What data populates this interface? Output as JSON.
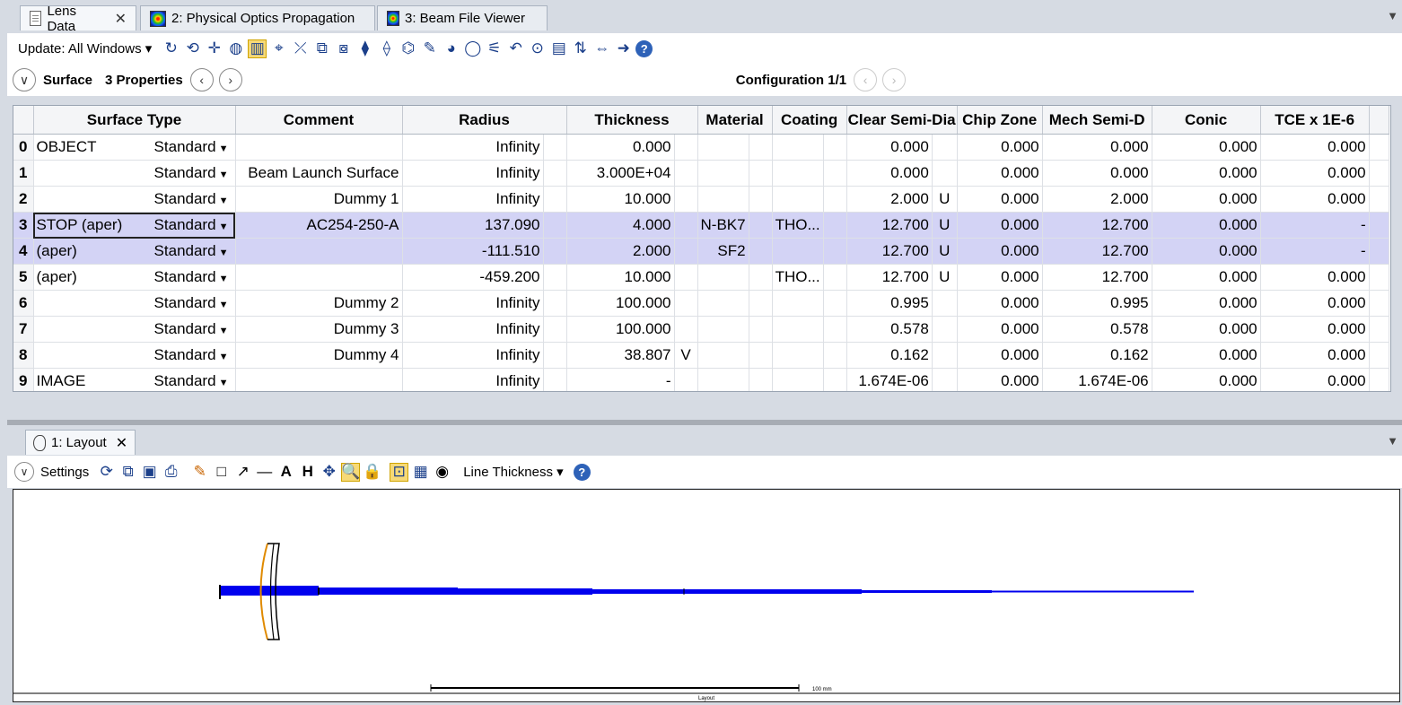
{
  "tabs": [
    {
      "label": "Lens Data",
      "icon": "document-icon",
      "active": true
    },
    {
      "label": "2: Physical Optics Propagation",
      "icon": "pop-heatmap-icon"
    },
    {
      "label": "3: Beam File Viewer",
      "icon": "beam-heatmap-icon"
    }
  ],
  "toolbar": {
    "update_label": "Update: All Windows"
  },
  "header": {
    "surface_label": "Surface",
    "properties_label": "3 Properties",
    "configuration_label": "Configuration 1/1"
  },
  "table": {
    "columns": [
      "Surface Type",
      "Comment",
      "Radius",
      "Thickness",
      "Material",
      "Coating",
      "Clear Semi-Dia",
      "Chip Zone",
      "Mech Semi-D",
      "Conic",
      "TCE x 1E-6"
    ],
    "rows": [
      {
        "idx": "0",
        "name": "OBJECT",
        "type": "Standard",
        "comment": "",
        "radius": "Infinity",
        "thickness": "0.000",
        "thick_flag": "",
        "material": "",
        "coating": "",
        "clear": "0.000",
        "clear_flag": "",
        "chip": "0.000",
        "mech": "0.000",
        "conic": "0.000",
        "tce": "0.000"
      },
      {
        "idx": "1",
        "name": "",
        "type": "Standard",
        "comment": "Beam Launch Surface",
        "radius": "Infinity",
        "thickness": "3.000E+04",
        "thick_flag": "",
        "material": "",
        "coating": "",
        "clear": "0.000",
        "clear_flag": "",
        "chip": "0.000",
        "mech": "0.000",
        "conic": "0.000",
        "tce": "0.000"
      },
      {
        "idx": "2",
        "name": "",
        "type": "Standard",
        "comment": "Dummy 1",
        "radius": "Infinity",
        "thickness": "10.000",
        "thick_flag": "",
        "material": "",
        "coating": "",
        "clear": "2.000",
        "clear_flag": "U",
        "chip": "0.000",
        "mech": "2.000",
        "conic": "0.000",
        "tce": "0.000"
      },
      {
        "idx": "3",
        "name": "STOP (aper)",
        "type": "Standard",
        "comment": "AC254-250-A",
        "radius": "137.090",
        "thickness": "4.000",
        "thick_flag": "",
        "material": "N-BK7",
        "coating": "THO...",
        "clear": "12.700",
        "clear_flag": "U",
        "chip": "0.000",
        "mech": "12.700",
        "conic": "0.000",
        "tce": "-"
      },
      {
        "idx": "4",
        "name": "(aper)",
        "type": "Standard",
        "comment": "",
        "radius": "-111.510",
        "thickness": "2.000",
        "thick_flag": "",
        "material": "SF2",
        "coating": "",
        "clear": "12.700",
        "clear_flag": "U",
        "chip": "0.000",
        "mech": "12.700",
        "conic": "0.000",
        "tce": "-"
      },
      {
        "idx": "5",
        "name": "(aper)",
        "type": "Standard",
        "comment": "",
        "radius": "-459.200",
        "thickness": "10.000",
        "thick_flag": "",
        "material": "",
        "coating": "THO...",
        "clear": "12.700",
        "clear_flag": "U",
        "chip": "0.000",
        "mech": "12.700",
        "conic": "0.000",
        "tce": "0.000"
      },
      {
        "idx": "6",
        "name": "",
        "type": "Standard",
        "comment": "Dummy 2",
        "radius": "Infinity",
        "thickness": "100.000",
        "thick_flag": "",
        "material": "",
        "coating": "",
        "clear": "0.995",
        "clear_flag": "",
        "chip": "0.000",
        "mech": "0.995",
        "conic": "0.000",
        "tce": "0.000"
      },
      {
        "idx": "7",
        "name": "",
        "type": "Standard",
        "comment": "Dummy 3",
        "radius": "Infinity",
        "thickness": "100.000",
        "thick_flag": "",
        "material": "",
        "coating": "",
        "clear": "0.578",
        "clear_flag": "",
        "chip": "0.000",
        "mech": "0.578",
        "conic": "0.000",
        "tce": "0.000"
      },
      {
        "idx": "8",
        "name": "",
        "type": "Standard",
        "comment": "Dummy 4",
        "radius": "Infinity",
        "thickness": "38.807",
        "thick_flag": "V",
        "material": "",
        "coating": "",
        "clear": "0.162",
        "clear_flag": "",
        "chip": "0.000",
        "mech": "0.162",
        "conic": "0.000",
        "tce": "0.000"
      },
      {
        "idx": "9",
        "name": "IMAGE",
        "type": "Standard",
        "comment": "",
        "radius": "Infinity",
        "thickness": "-",
        "thick_flag": "",
        "material": "",
        "coating": "",
        "clear": "1.674E-06",
        "clear_flag": "",
        "chip": "0.000",
        "mech": "1.674E-06",
        "conic": "0.000",
        "tce": "0.000"
      }
    ]
  },
  "layout_tab": {
    "label": "1: Layout"
  },
  "layout_toolbar": {
    "settings_label": "Settings",
    "line_thickness_label": "Line Thickness"
  },
  "layout_view": {
    "scale_label": "100 mm",
    "caption": "Layout",
    "beam_color": "#0000ee",
    "lens_edge_color": "#e08a00"
  },
  "colors": {
    "highlight_row": "#d3d3f5",
    "tab_bg": "#d6dbe3",
    "selected_tool": "#f6d977"
  }
}
